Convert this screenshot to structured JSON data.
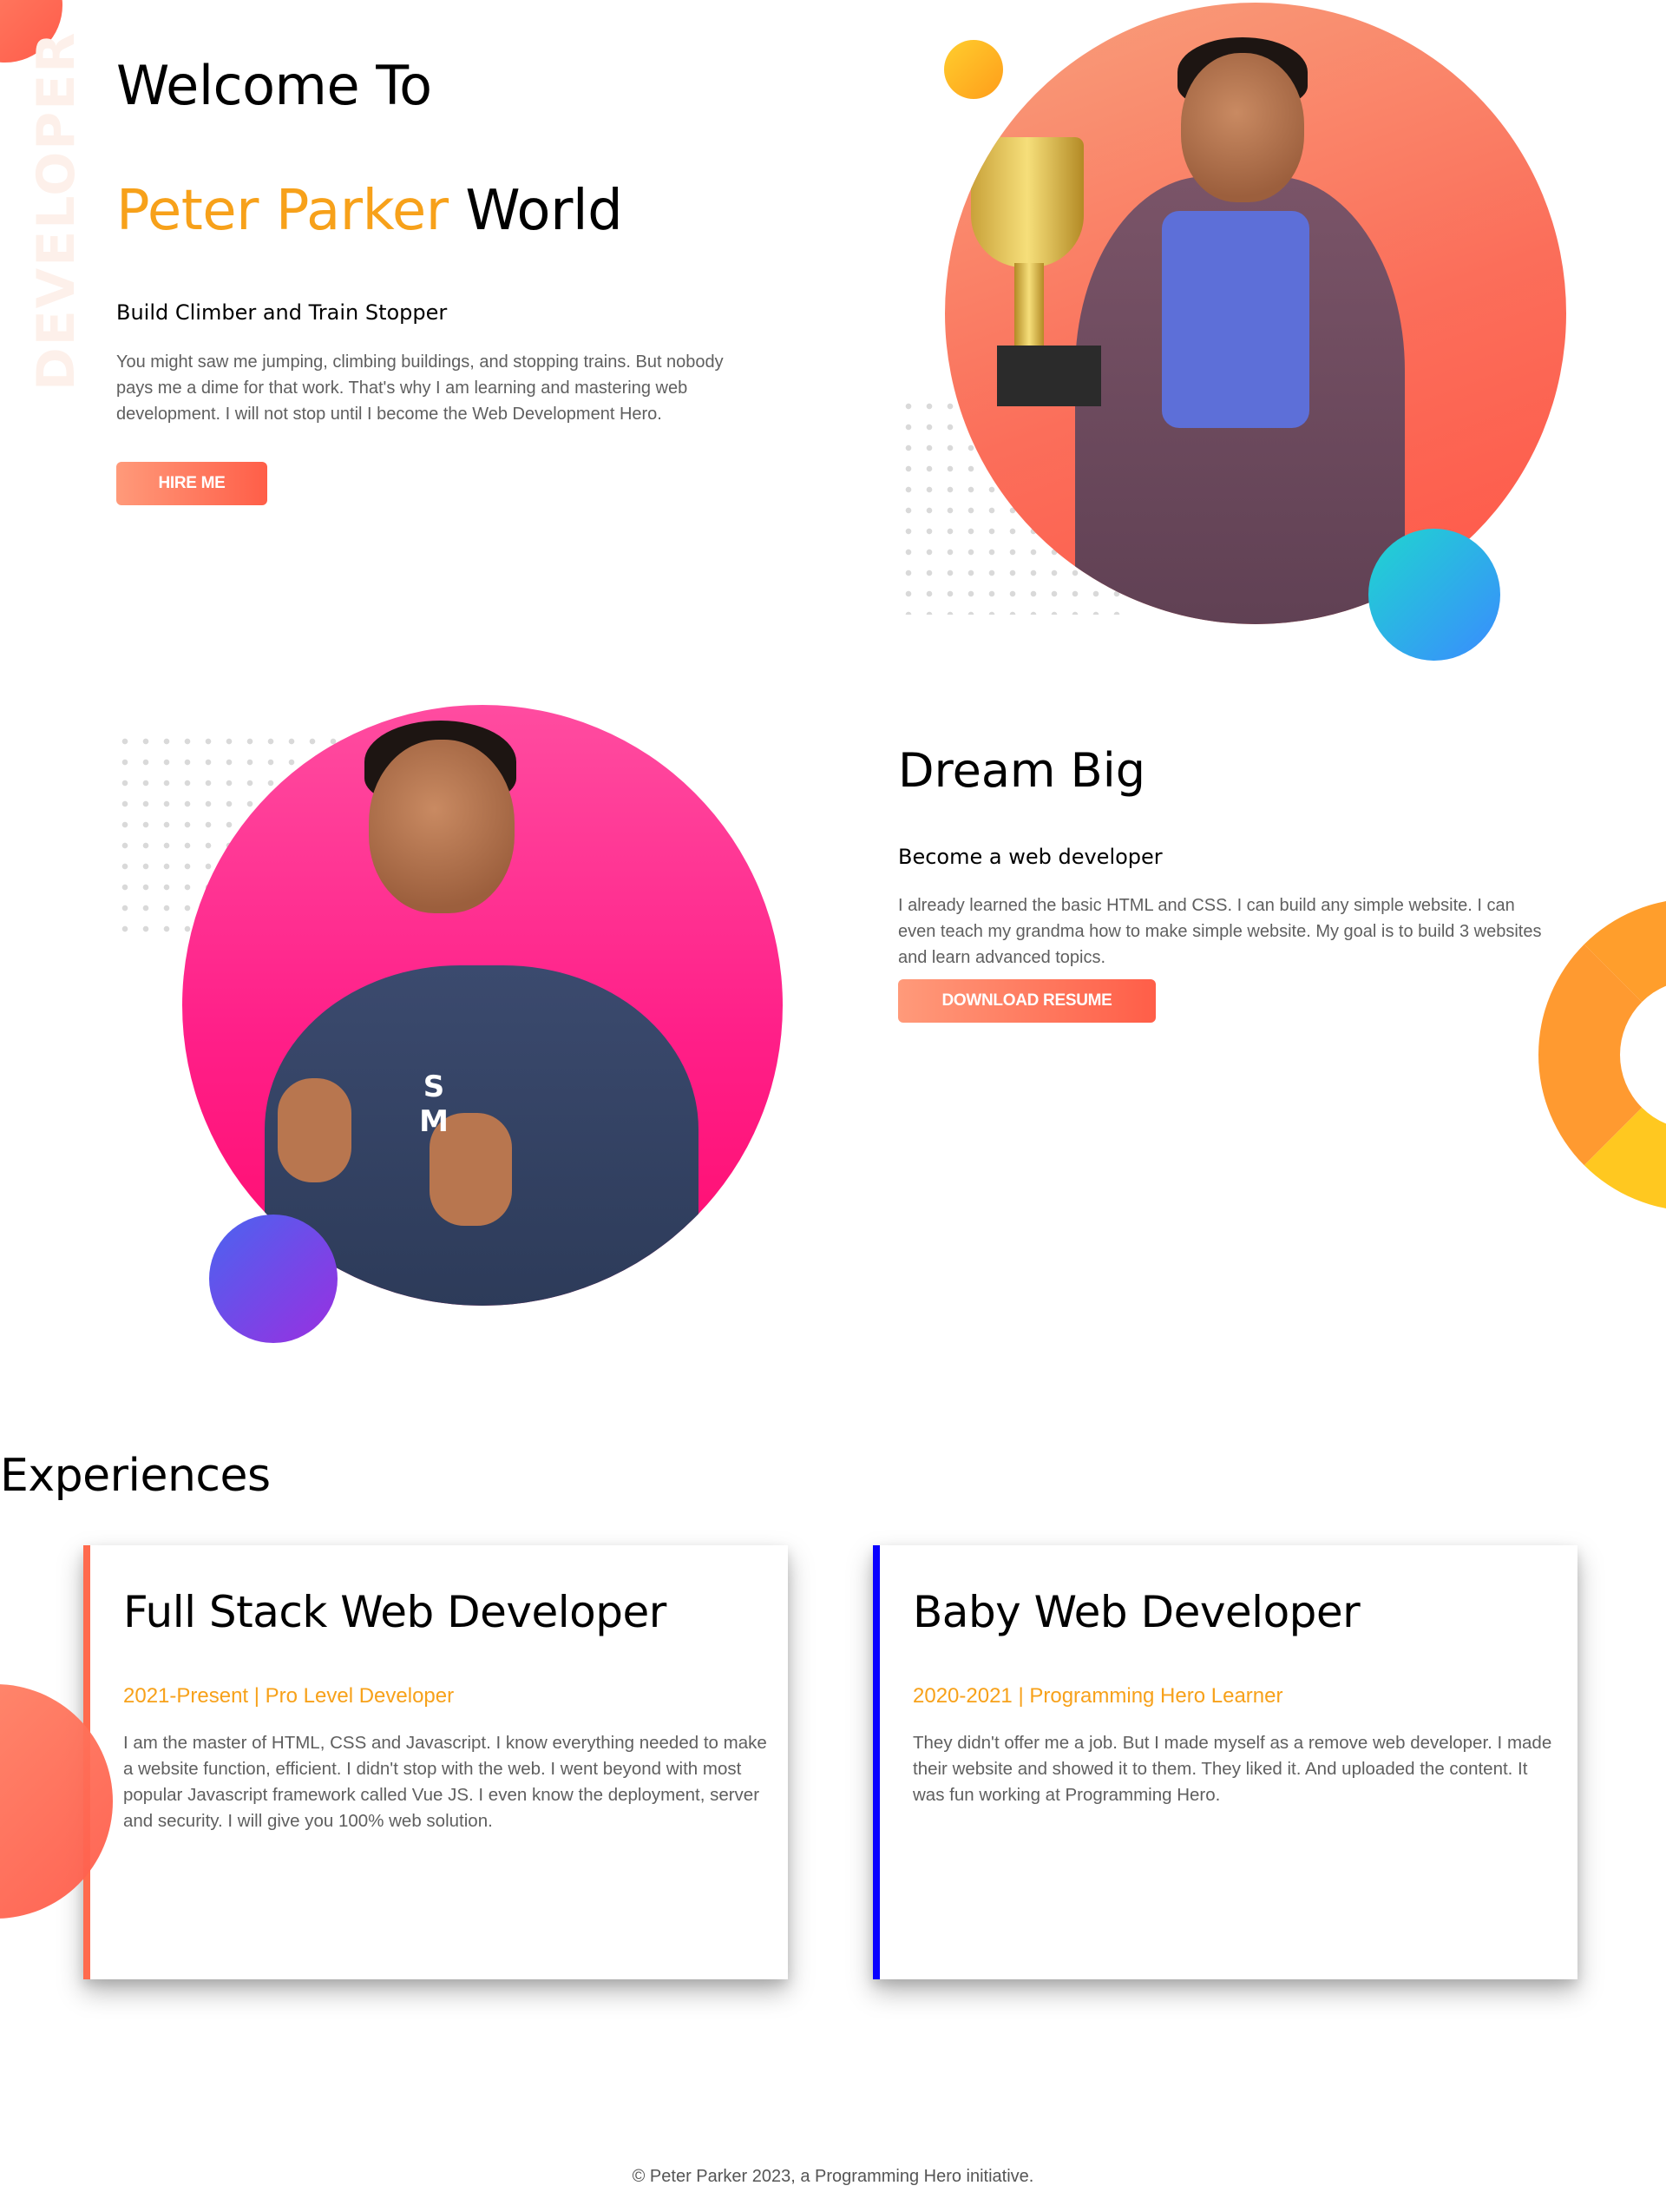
{
  "decor": {
    "vertical_word": "DEVELOPER"
  },
  "hero": {
    "welcome": "Welcome To",
    "name_accent": "Peter Parker",
    "name_rest": " World",
    "subtitle": "Build Climber and Train Stopper",
    "paragraph": "You might saw me jumping, climbing buildings, and stopping trains. But nobody pays me a dime for that work. That's why I am learning and mastering web development. I will not stop until I become the Web Development Hero.",
    "button_label": "HIRE ME"
  },
  "dream": {
    "title": "Dream Big",
    "subtitle": "Become a web developer",
    "paragraph": "I already learned the basic HTML and CSS. I can build any simple website. I can even teach my grandma how to make simple website. My goal is to build 3 websites and learn advanced topics.",
    "button_label": "DOWNLOAD RESUME"
  },
  "experiences": {
    "title": "Experiences",
    "items": [
      {
        "title": "Full Stack Web Developer",
        "period": "2021-Present | Pro Level Developer",
        "description": "I am the master of HTML, CSS and Javascript. I know everything needed to make a website function, efficient. I didn't stop with the web. I went beyond with most popular Javascript framework called Vue JS. I even know the deployment, server and security. I will give you 100% web solution.",
        "accent_color": "#ff6a4d"
      },
      {
        "title": "Baby Web Developer",
        "period": "2020-2021 | Programming Hero Learner",
        "description": "They didn't offer me a job. But I made myself as a remove web developer. I made their website and showed it to them. They liked it. And uploaded the content. It was fun working at Programming Hero.",
        "accent_color": "#0a00ff"
      }
    ]
  },
  "footer": {
    "text": "© Peter Parker 2023, a Programming Hero initiative."
  },
  "colors": {
    "accent": "#f7a11a",
    "button_start": "#ff9a7a",
    "button_end": "#ff5e48"
  }
}
